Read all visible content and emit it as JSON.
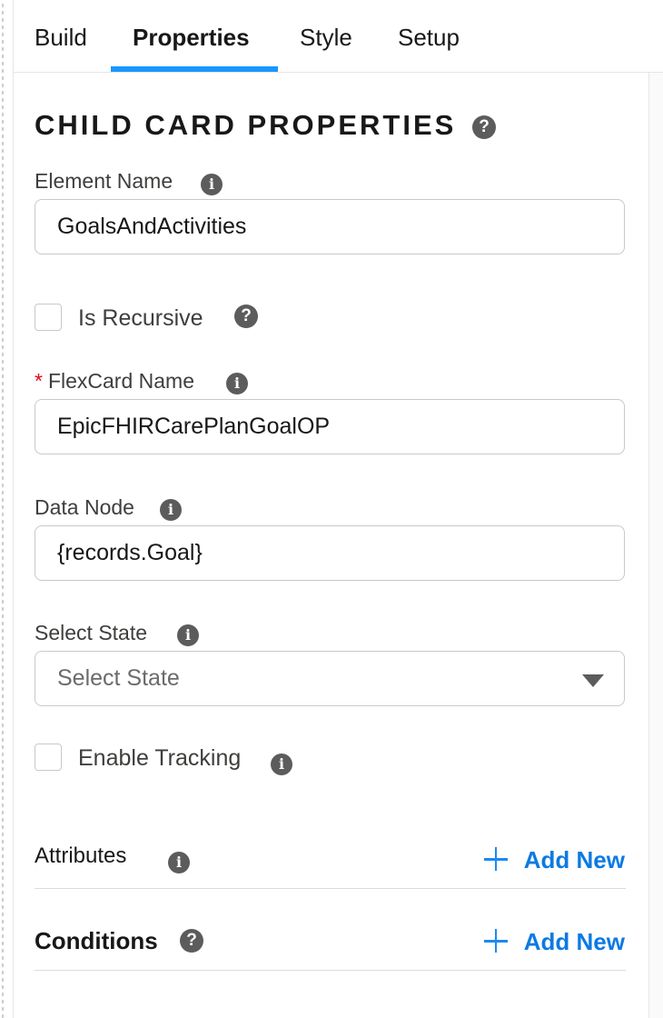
{
  "tabs": [
    {
      "label": "Build"
    },
    {
      "label": "Properties"
    },
    {
      "label": "Style"
    },
    {
      "label": "Setup"
    }
  ],
  "active_tab": "Properties",
  "section": {
    "title": "CHILD CARD PROPERTIES",
    "help_glyph": "?"
  },
  "fields": {
    "element_name": {
      "label": "Element Name",
      "value": "GoalsAndActivities"
    },
    "is_recursive": {
      "label": "Is Recursive",
      "checked": false
    },
    "flexcard_name": {
      "required_marker": "*",
      "label": "FlexCard Name",
      "value": "EpicFHIRCarePlanGoalOP"
    },
    "data_node": {
      "label": "Data Node",
      "value": "{records.Goal}"
    },
    "select_state": {
      "label": "Select State",
      "placeholder": "Select State"
    },
    "enable_tracking": {
      "label": "Enable Tracking",
      "checked": false
    }
  },
  "attributes": {
    "label": "Attributes",
    "add_label": "Add New"
  },
  "conditions": {
    "label": "Conditions",
    "add_label": "Add New"
  },
  "info_glyph": "i",
  "colors": {
    "accent": "#1b96ff",
    "link": "#0b7ae3",
    "required": "#ea001e",
    "icon": "#5c5c5c"
  }
}
